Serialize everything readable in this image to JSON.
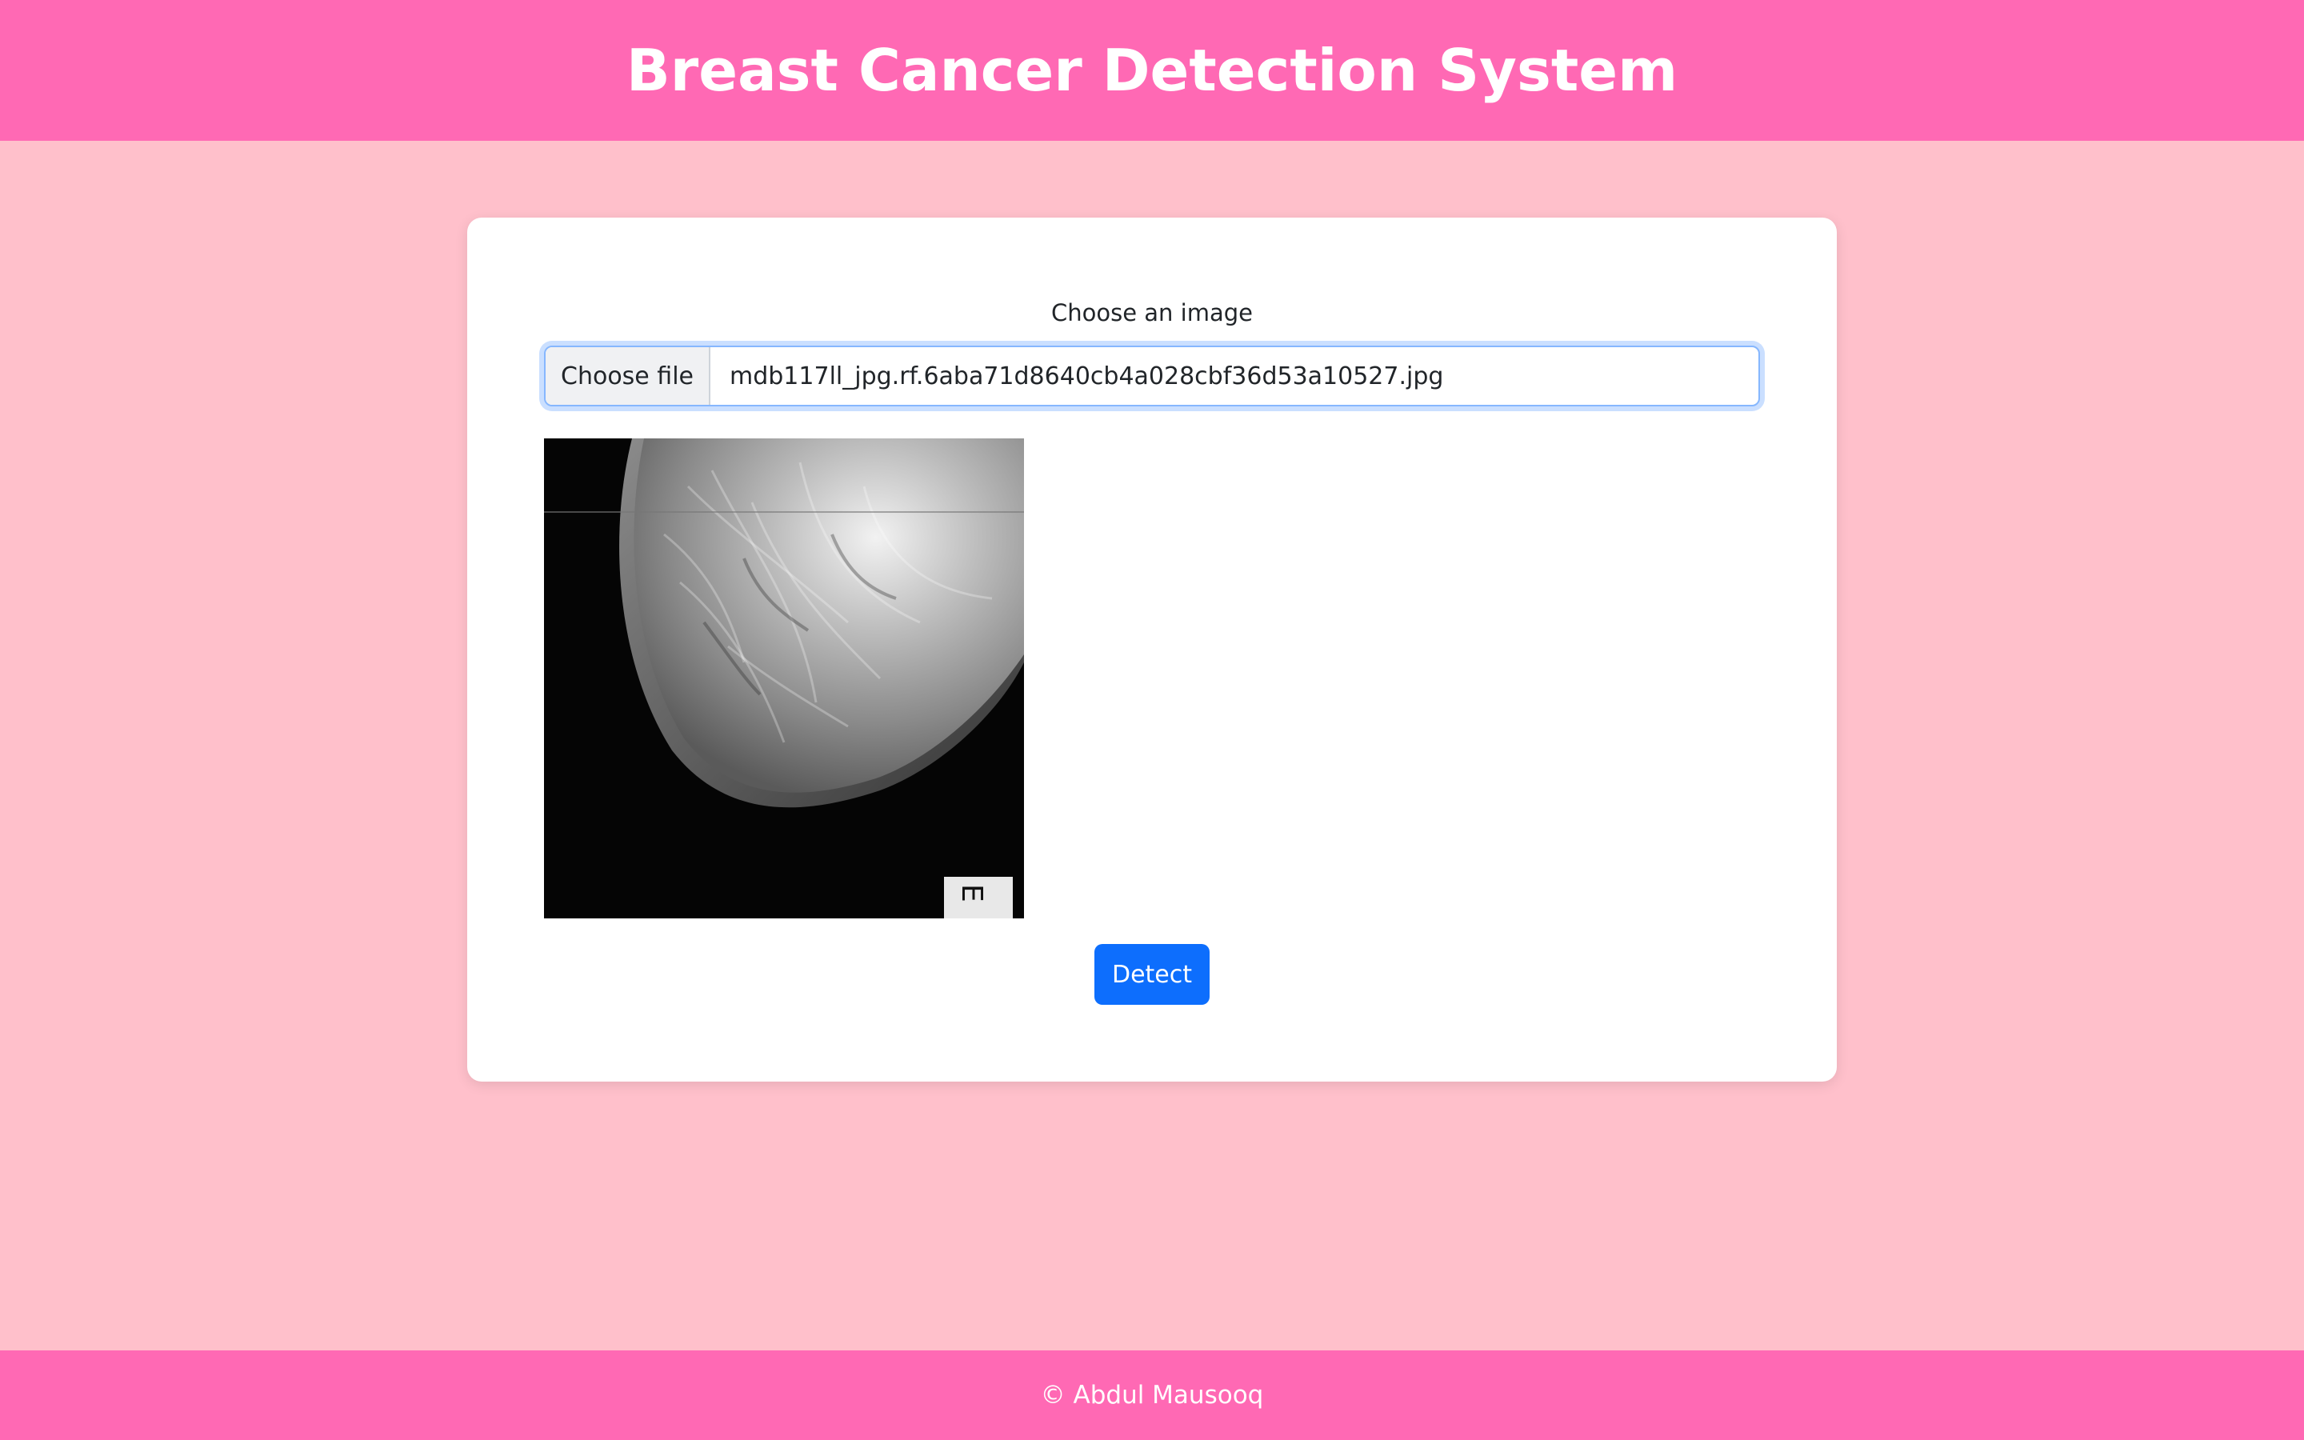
{
  "header": {
    "title": "Breast Cancer Detection System"
  },
  "form": {
    "label": "Choose an image",
    "file_button_label": "Choose file",
    "file_name": "mdb117ll_jpg.rf.6aba71d8640cb4a028cbf36d53a10527.jpg",
    "preview_image_alt": "Uploaded mammogram preview",
    "detect_label": "Detect"
  },
  "footer": {
    "text": "© Abdul Mausooq"
  },
  "colors": {
    "header_bg": "#ff69b4",
    "page_bg": "#ffc0cb",
    "card_bg": "#ffffff",
    "primary": "#0d6efd"
  }
}
